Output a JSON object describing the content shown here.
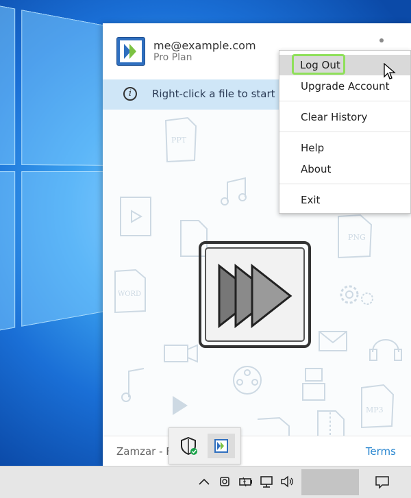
{
  "account": {
    "email": "me@example.com",
    "plan": "Pro Plan"
  },
  "info_bar": {
    "text": "Right-click a file to start cor"
  },
  "menu": {
    "items": [
      {
        "label": "Log Out",
        "highlighted": true
      },
      {
        "label": "Upgrade Account"
      },
      {
        "label": "Clear History"
      },
      {
        "label": "Help"
      },
      {
        "label": "About"
      },
      {
        "label": "Exit"
      }
    ]
  },
  "footer": {
    "text": "Zamzar - F",
    "terms_label": "Terms"
  },
  "doodles": {
    "ppt": "PPT",
    "word": "WORD",
    "png": "PNG",
    "mp3": "MP3"
  },
  "colors": {
    "accent_link": "#2a87d0",
    "info_bar_bg": "#cfe6f7",
    "highlight_border": "#8fe05a",
    "logo_blue": "#2f6fbf"
  },
  "icons": {
    "tray": [
      "chevron-up-icon",
      "webcam-icon",
      "battery-icon",
      "network-icon",
      "volume-icon"
    ],
    "notification": "action-center-icon"
  }
}
